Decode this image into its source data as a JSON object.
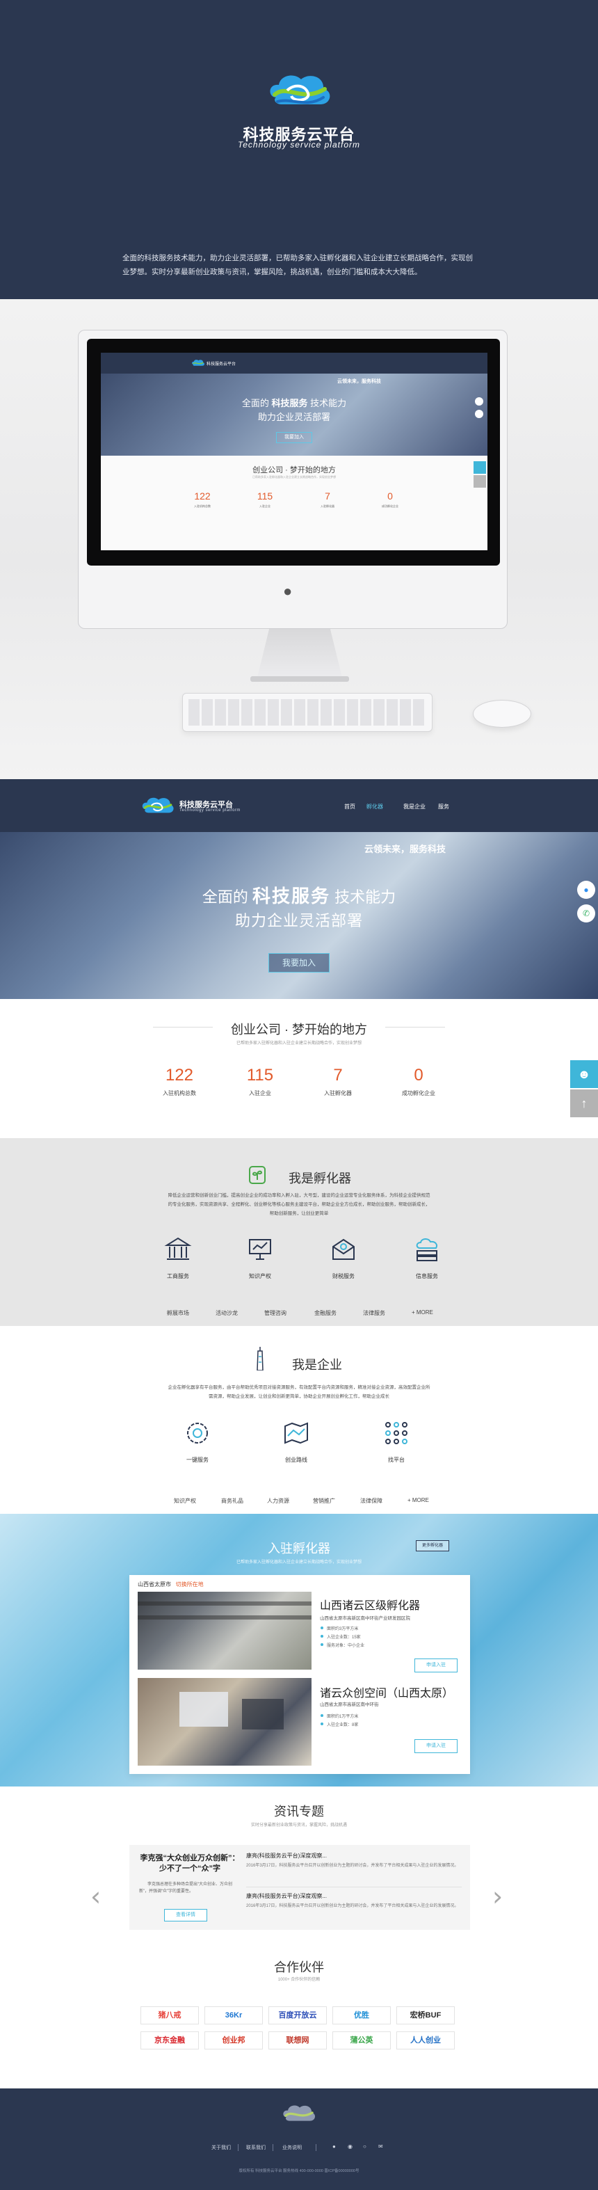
{
  "brand": {
    "title": "科技服务云平台",
    "subtitle": "Technology service platform",
    "desc": "全面的科技服务技术能力，助力企业灵活部署，已帮助多家入驻孵化器和入驻企业建立长期战略合作，实现创业梦想。实时分享最新创业政策与资讯，掌握风险，挑战机遇，创业的门槛和成本大大降低。"
  },
  "colors": {
    "navy": "#2b3750",
    "accent": "#3fb6d9",
    "number": "#e25a2b"
  },
  "nav": {
    "brand": "科技服务云平台",
    "brand_sub": "Technology service platform",
    "items": [
      "首页",
      "孵化器",
      "我是企业",
      "服务"
    ]
  },
  "banner": {
    "tag": "云领未来，服务科技",
    "line1_pre": "全面的",
    "line1_strong": "科技服务",
    "line1_post": "技术能力",
    "line2": "助力企业灵活部署",
    "cta": "我要加入"
  },
  "float": {
    "chat_icon": "chat-icon",
    "phone_icon": "phone-icon",
    "user_icon": "user-icon",
    "top_icon": "arrow-up-icon"
  },
  "startup": {
    "title": "创业公司 · 梦开始的地方",
    "subtitle": "已帮助多家入驻孵化器和入驻企业建立长期战略合作，实现创业梦想",
    "stats": [
      {
        "value": "122",
        "label": "入驻机构总数"
      },
      {
        "value": "115",
        "label": "入驻企业"
      },
      {
        "value": "7",
        "label": "入驻孵化器"
      },
      {
        "value": "0",
        "label": "成功孵化企业"
      }
    ]
  },
  "incubator": {
    "title": "我是孵化器",
    "desc": "降低企业运营和创新创业门槛，提高创业企业的成功率和入孵入驻，大号型，建设的企业运营专业化服务体系，为科技企业提供规范的专业化服务，实现资源共享、全程孵化、创业孵化等核心服务主建设平台，帮助企业全方位成长，帮助创业服务，帮助创新成长，帮助创新服务，让创业更简单",
    "services": [
      {
        "label": "工商服务",
        "icon": "bank-icon"
      },
      {
        "label": "知识产权",
        "icon": "presentation-icon"
      },
      {
        "label": "财税服务",
        "icon": "envelope-icon"
      },
      {
        "label": "信息服务",
        "icon": "cloud-server-icon"
      }
    ],
    "links": [
      "孵展市场",
      "活动沙龙",
      "管理咨询",
      "金融服务",
      "法律服务",
      "+ MORE"
    ]
  },
  "enterprise": {
    "title": "我是企业",
    "desc": "企业在孵化器享有平台服务，由平台帮助优秀项目对接资源服务，有效配置平台内资源和服务，精准对接企业资源，高效配置企业所需资源，帮助企业发展，让创业和创新更简单，协助企业开展创业孵化工作，帮助企业成长",
    "services": [
      {
        "label": "一键服务",
        "icon": "gear-icon"
      },
      {
        "label": "创业路线",
        "icon": "map-icon"
      },
      {
        "label": "找平台",
        "icon": "network-icon"
      }
    ],
    "links": [
      "知识产权",
      "商务礼品",
      "人力资源",
      "营销推广",
      "法律保障",
      "+ MORE"
    ]
  },
  "join": {
    "title": "入驻孵化器",
    "more": "更多孵化器",
    "subtitle": "已帮助多家入驻孵化器和入驻企业建立长期战略合作，实现创业梦想",
    "location_label": "山西省太原市",
    "location_switch": "切换所在地",
    "incubators": [
      {
        "name": "山西诸云区级孵化器",
        "address": "山西省太原市高新区南中环街产业研发园区院",
        "details": [
          "面积约3万平方米",
          "入驻企业数：15家",
          "服务对象：中小企业"
        ],
        "cta": "申请入驻"
      },
      {
        "name": "诸云众创空间（山西太原）",
        "address": "山西省太原市高新区南中环街",
        "details": [
          "面积约1万平方米",
          "入驻企业数：8家"
        ],
        "cta": "申请入驻"
      }
    ]
  },
  "news": {
    "title": "资讯专题",
    "subtitle": "实时分享最新创业政策与资讯，掌握风险，挑战机遇",
    "feature_title": "李克强“大众创业万众创新”：少不了一个“众”字",
    "feature_desc": "李克强总理在多种场合提出“大众创业、万众创新”，并强调“众”字的重要性。",
    "feature_cta": "查看详情",
    "items": [
      {
        "title": "康亮(科技服务云平台)深度观察...",
        "text": "2016年3月17日，科技服务云平台召开以创新创业为主题的研讨会，并发布了平台相关成果与入驻企业的发展情况。"
      },
      {
        "title": "康亮(科技服务云平台)深度观察...",
        "text": "2016年3月17日，科技服务云平台召开以创新创业为主题的研讨会，并发布了平台相关成果与入驻企业的发展情况。"
      }
    ]
  },
  "partners": {
    "title": "合作伙伴",
    "subtitle": "1000+ 合作伙伴的信赖",
    "logos": [
      "猪八戒",
      "36Kr",
      "百度开放云",
      "优胜",
      "宏桥BUF",
      "京东金融",
      "创业邦",
      "联想网",
      "蒲公英",
      "人人创业"
    ]
  },
  "footer": {
    "links": [
      "关于我们",
      "联系我们",
      "业务说明"
    ],
    "icons": [
      "wechat-icon",
      "weibo-icon",
      "qq-icon",
      "email-icon"
    ],
    "copyright": "版权所有 科技服务云平台 服务热线 400-000-0000 晋ICP备00000000号"
  }
}
